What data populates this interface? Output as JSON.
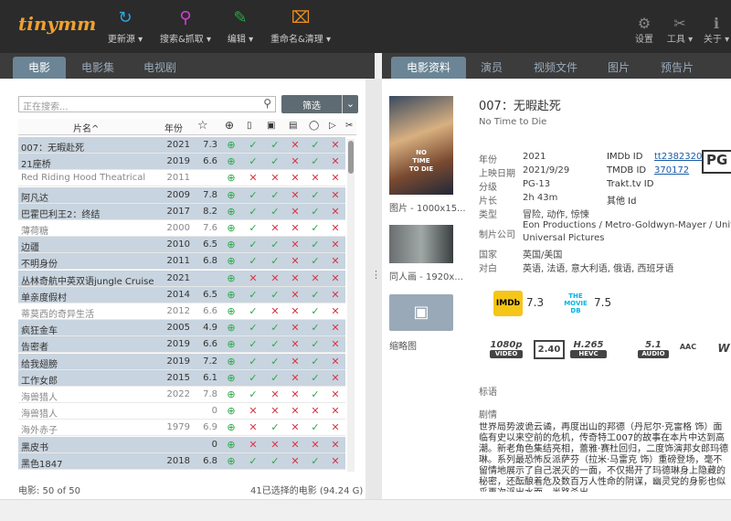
{
  "app": {
    "logo": "tinymm"
  },
  "toolbar": [
    {
      "label": "更新源 ▾",
      "icon": "refresh-icon",
      "color": "#2aa6e0"
    },
    {
      "label": "搜索&抓取 ▾",
      "icon": "search-icon",
      "color": "#d040d8"
    },
    {
      "label": "编辑 ▾",
      "icon": "pencil-icon",
      "color": "#28a745"
    },
    {
      "label": "重命名&清理 ▾",
      "icon": "rename-icon",
      "color": "#f09020"
    }
  ],
  "righttools": [
    {
      "label": "设置",
      "icon": "gear-icon"
    },
    {
      "label": "工具 ▾",
      "icon": "wrench-icon"
    },
    {
      "label": "关于 ▾",
      "icon": "info-icon"
    }
  ],
  "lefttabs": [
    "电影",
    "电影集",
    "电视剧"
  ],
  "righttabs": [
    "电影资料",
    "演员",
    "视频文件",
    "图片",
    "预告片"
  ],
  "search": {
    "placeholder": "正在搜索...",
    "filter": "筛选"
  },
  "columns": {
    "title": "片名^",
    "year": "年份"
  },
  "movies": [
    {
      "title": "007：无暇赴死",
      "year": "2021",
      "rating": "7.3",
      "status": "gggxgx",
      "sel": true
    },
    {
      "title": "21座桥",
      "year": "2019",
      "rating": "6.6",
      "status": "gggxgx",
      "sel": true
    },
    {
      "title": "Red Riding Hood Theatrical",
      "year": "2011",
      "rating": "",
      "status": "gxxxxx",
      "grey": true
    },
    {
      "title": "阿凡达",
      "year": "2009",
      "rating": "7.8",
      "status": "gggxgx",
      "sel": true
    },
    {
      "title": "巴霍巴利王2：终结",
      "year": "2017",
      "rating": "8.2",
      "status": "gggxgx",
      "sel": true
    },
    {
      "title": "薄荷糖",
      "year": "2000",
      "rating": "7.6",
      "status": "ggxxgx",
      "grey": true
    },
    {
      "title": "边疆",
      "year": "2010",
      "rating": "6.5",
      "status": "gggxgx",
      "sel": true
    },
    {
      "title": "不明身份",
      "year": "2011",
      "rating": "6.8",
      "status": "gggxgx",
      "sel": true
    },
    {
      "title": "丛林奇航中英双语jungle Cruise",
      "year": "2021",
      "rating": "",
      "status": "gxxxxx",
      "sel": true
    },
    {
      "title": "单亲度假村",
      "year": "2014",
      "rating": "6.5",
      "status": "gggxgx",
      "sel": true
    },
    {
      "title": "蒂莫西的奇异生活",
      "year": "2012",
      "rating": "6.6",
      "status": "ggxxgx",
      "grey": true
    },
    {
      "title": "疯狂金车",
      "year": "2005",
      "rating": "4.9",
      "status": "gggxgx",
      "sel": true
    },
    {
      "title": "告密者",
      "year": "2019",
      "rating": "6.6",
      "status": "gggxgx",
      "sel": true
    },
    {
      "title": "给我翅膀",
      "year": "2019",
      "rating": "7.2",
      "status": "gggxgx",
      "sel": true
    },
    {
      "title": "工作女郎",
      "year": "2015",
      "rating": "6.1",
      "status": "gggxgx",
      "sel": true
    },
    {
      "title": "海兽猎人",
      "year": "2022",
      "rating": "7.8",
      "status": "ggxxgx",
      "grey": true
    },
    {
      "title": "海兽猎人",
      "year": "",
      "rating": "0",
      "status": "gxxxxx",
      "grey": true
    },
    {
      "title": "海外赤子",
      "year": "1979",
      "rating": "6.9",
      "status": "gxgxgx",
      "grey": true
    },
    {
      "title": "黑皮书",
      "year": "",
      "rating": "0",
      "status": "gxxxxx",
      "sel": true
    },
    {
      "title": "黑色1847",
      "year": "2018",
      "rating": "6.8",
      "status": "gggxgx",
      "sel": true
    }
  ],
  "status": {
    "count": "电影:  50  of  50",
    "selected": "41已选择的电影 (94.24 G)"
  },
  "detail": {
    "title": "007：无暇赴死",
    "original": "No Time to Die",
    "poster_text": "NO TIME TO DIE",
    "poster_cap": "图片 - 1000x15...",
    "fanart_cap": "同人画 - 1920x...",
    "thumb_cap": "缩略图",
    "labels": [
      "年份",
      "上映日期",
      "分级",
      "片长",
      "类型",
      "制片公司",
      "国家",
      "对白"
    ],
    "values": [
      "2021",
      "2021/9/29",
      "PG-13",
      "2h 43m",
      "冒险, 动作, 惊悚",
      "Eon Productions / Metro-Goldwyn-Mayer / United A",
      "英国/美国",
      "英语, 法语, 意大利语, 俄语, 西班牙语"
    ],
    "value_extra": "Universal Pictures",
    "ids": {
      "imdb_label": "IMDb ID",
      "imdb": "tt2382320",
      "tmdb_label": "TMDB ID",
      "tmdb": "370172",
      "trakt_label": "Trakt.tv ID",
      "other_label": "其他 Id"
    },
    "cert_badge": "PG",
    "ratings": {
      "imdb": "7.3",
      "tmdb": "7.5",
      "imdb_logo": "IMDb",
      "tmdb_logo": "THE MOVIE DB"
    },
    "media": [
      {
        "top": "1080p",
        "bottom": "VIDEO"
      },
      {
        "top": "2.40",
        "bottom": ""
      },
      {
        "top": "H.265",
        "bottom": "HEVC"
      },
      {
        "top": "5.1",
        "bottom": "AUDIO"
      },
      {
        "top": "AAC",
        "bottom": ""
      }
    ],
    "tagline_label": "标语",
    "plot_label": "剧情",
    "plot": "世界局势波诡云谲，再度出山的邦德（丹尼尔·克雷格 饰）面临有史以来空前的危机，传奇特工007的故事在本片中达到高潮。新老角色集结亮相，蕾雅·赛杜回归，二度饰演邦女郎玛德琳。系列最恐怖反派萨芬（拉米·马雷克 饰）重磅登场，毫不留情地展示了自己泯灭的一面，不仅揭开了玛德琳身上隐藏的秘密，还酝酿着危及数百万人性命的阴谋，幽灵党的身影也似乎再次浮出水面。半路杀出"
  }
}
